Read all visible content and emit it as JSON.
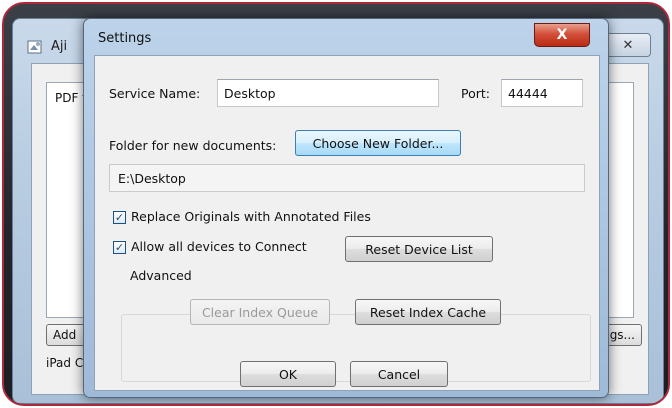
{
  "background_window": {
    "title": "Aji",
    "list_header": "PDF f",
    "add_button": "Add",
    "settings_button": "gs...",
    "status_text": "iPad C"
  },
  "dialog": {
    "title": "Settings",
    "close_glyph": "X",
    "service_name": {
      "label": "Service Name:",
      "value": "Desktop"
    },
    "port": {
      "label": "Port:",
      "value": "44444"
    },
    "folder": {
      "label": "Folder for new documents:",
      "button": "Choose New Folder...",
      "path": "E:\\Desktop"
    },
    "replace_originals": {
      "label": "Replace Originals with Annotated Files",
      "checked": true
    },
    "allow_devices": {
      "label": "Allow all devices to Connect",
      "checked": true
    },
    "reset_device_list": "Reset Device List",
    "advanced": {
      "legend": "Advanced",
      "clear_index_queue": "Clear Index Queue",
      "reset_index_cache": "Reset Index Cache"
    },
    "ok": "OK",
    "cancel": "Cancel"
  },
  "colors": {
    "frame": "#b0273a",
    "close_button": "#c83a22",
    "title_bar": "#aac4df"
  }
}
